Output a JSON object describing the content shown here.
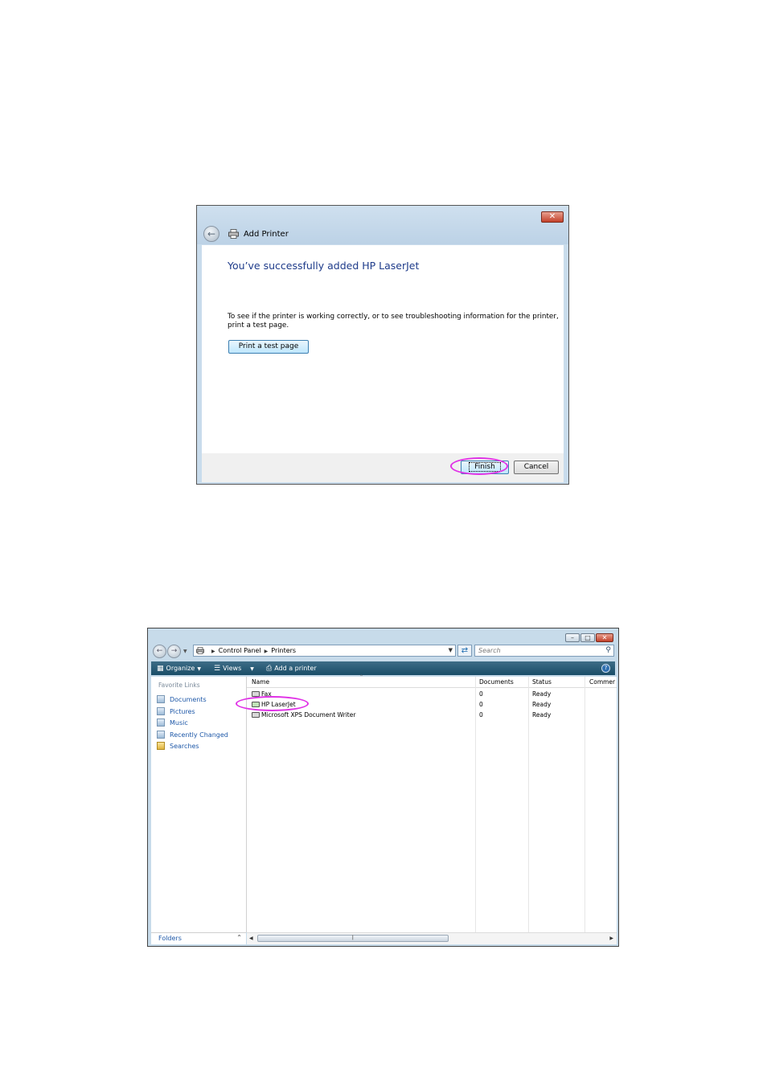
{
  "add_printer_dialog": {
    "title": "Add Printer",
    "close_glyph": "✕",
    "heading": "You’ve successfully added HP LaserJet",
    "description": "To see if the printer is working correctly, or to see troubleshooting information for the printer, print a test page.",
    "print_test_button": "Print a test page",
    "finish_button": "Finish",
    "cancel_button": "Cancel"
  },
  "printers_window": {
    "window_controls": {
      "minimize": "–",
      "maximize": "□",
      "close": "✕"
    },
    "address_bar": {
      "crumbs": [
        "Control Panel",
        "Printers"
      ]
    },
    "search_placeholder": "Search",
    "toolbar": {
      "organize": "Organize",
      "views": "Views",
      "add_printer": "Add a printer"
    },
    "favorite_links": {
      "title": "Favorite Links",
      "items": [
        "Documents",
        "Pictures",
        "Music",
        "Recently Changed",
        "Searches"
      ]
    },
    "folders_label": "Folders",
    "columns": [
      "Name",
      "Documents",
      "Status",
      "Commer"
    ],
    "printers": [
      {
        "name": "Fax",
        "documents": "0",
        "status": "Ready"
      },
      {
        "name": "HP LaserJet",
        "documents": "0",
        "status": "Ready"
      },
      {
        "name": "Microsoft XPS Document Writer",
        "documents": "0",
        "status": "Ready"
      }
    ]
  },
  "highlight_color": "#e032e6"
}
